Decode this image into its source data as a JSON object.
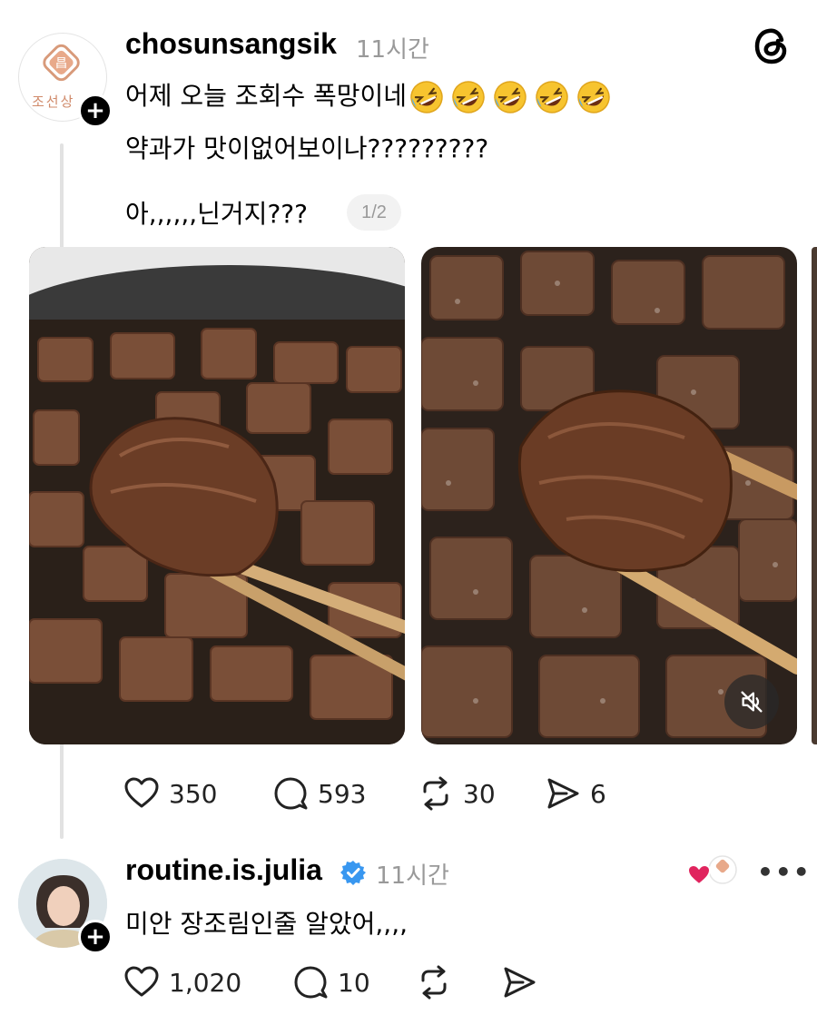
{
  "post": {
    "username": "chosunsangsik",
    "time": "11시간",
    "avatar_text": "조선상",
    "text_line1": "어제 오늘 조회수 폭망이네",
    "emoji_name": "rolling-on-the-floor-laughing",
    "emoji_count": 5,
    "text_line2": "약과가 맛이없어보이나?????????",
    "text_line3": "아,,,,,,닌거지???",
    "page_indicator": "1/2",
    "likes": "350",
    "comments": "593",
    "reposts": "30",
    "shares": "6"
  },
  "reply": {
    "username": "routine.is.julia",
    "time": "11시간",
    "verified": true,
    "text": "미안 장조림인줄 알았어,,,,",
    "likes": "1,020",
    "comments": "10",
    "more_label": "•••"
  },
  "icons": {
    "app_logo": "threads-icon",
    "like": "heart-icon",
    "comment": "comment-icon",
    "repost": "repost-icon",
    "share": "share-icon",
    "mute": "muted-speaker-icon"
  },
  "colors": {
    "text": "#000000",
    "muted": "#999999",
    "verified": "#3897f0",
    "liked_heart": "#e0245e"
  }
}
